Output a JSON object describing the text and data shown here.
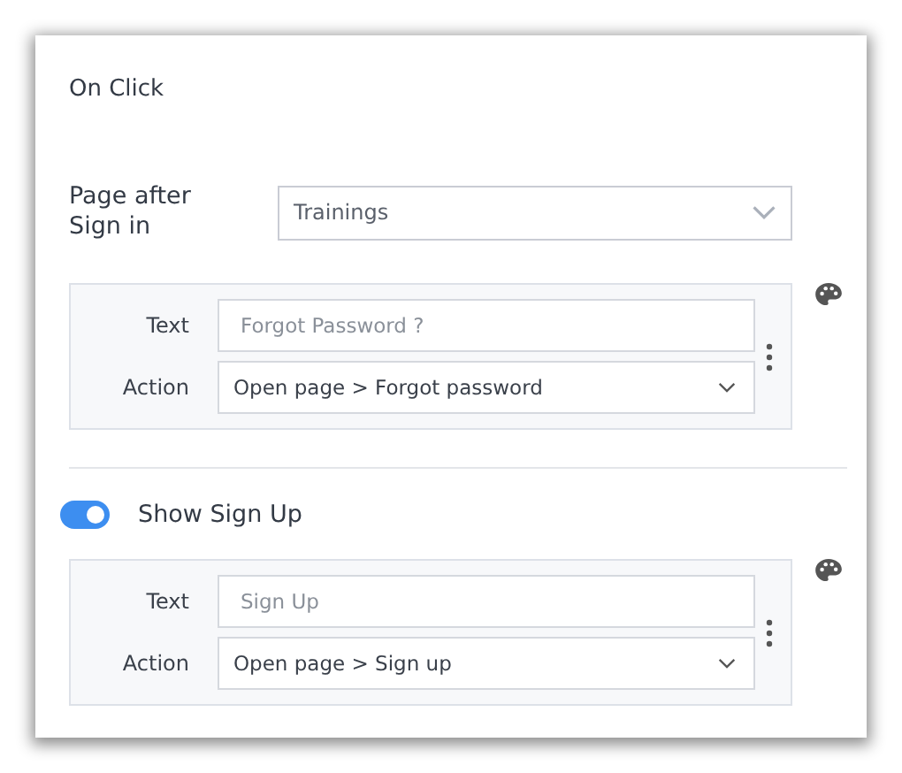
{
  "section_title": "On Click",
  "page_after_sign_in": {
    "label": "Page after Sign in",
    "value": "Trainings"
  },
  "forgot_password_link": {
    "fields": [
      {
        "kind": "text",
        "label": "Text",
        "placeholder": "Forgot Password ?"
      },
      {
        "kind": "select",
        "label": "Action",
        "value": "Open page > Forgot password"
      }
    ]
  },
  "sign_up_toggle": {
    "label": "Show Sign Up",
    "on": true
  },
  "sign_up_link": {
    "fields": [
      {
        "kind": "text",
        "label": "Text",
        "placeholder": "Sign Up"
      },
      {
        "kind": "select",
        "label": "Action",
        "value": "Open page > Sign up"
      }
    ]
  }
}
